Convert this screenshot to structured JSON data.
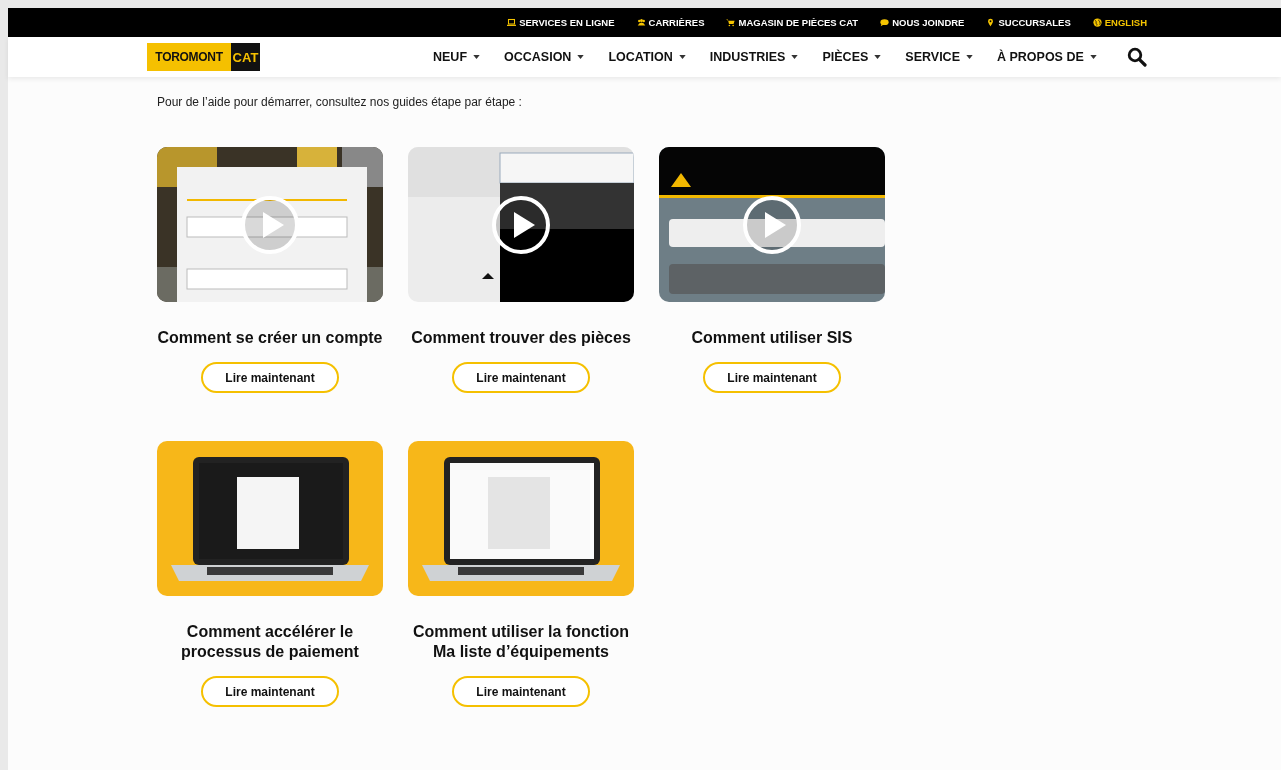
{
  "top_bar": {
    "links": [
      {
        "label": "SERVICES EN LIGNE",
        "highlight": false
      },
      {
        "label": "CARRIÈRES",
        "highlight": false
      },
      {
        "label": "MAGASIN DE PIÈCES CAT",
        "highlight": false
      },
      {
        "label": "NOUS JOINDRE",
        "highlight": false
      },
      {
        "label": "SUCCURSALES",
        "highlight": false
      },
      {
        "label": "ENGLISH",
        "highlight": true
      }
    ]
  },
  "logo": {
    "left": "TOROMONT",
    "right": "CAT"
  },
  "nav": {
    "items": [
      "NEUF",
      "OCCASION",
      "LOCATION",
      "INDUSTRIES",
      "PIÈCES",
      "SERVICE",
      "À PROPOS DE"
    ]
  },
  "intro": "Pour de l’aide pour démarrer, consultez nos guides étape par étape :",
  "guides": [
    {
      "kind": "video",
      "title": "Comment se créer un compte",
      "button": "Lire maintenant"
    },
    {
      "kind": "video",
      "title": "Comment trouver des pièces",
      "button": "Lire maintenant"
    },
    {
      "kind": "video",
      "title": "Comment utiliser SIS",
      "button": "Lire maintenant"
    },
    {
      "kind": "laptop",
      "title": "Comment accélérer le processus de paiement",
      "button": "Lire maintenant"
    },
    {
      "kind": "laptop",
      "title": "Comment utiliser la fonction Ma liste d’équipements",
      "button": "Lire maintenant"
    }
  ]
}
